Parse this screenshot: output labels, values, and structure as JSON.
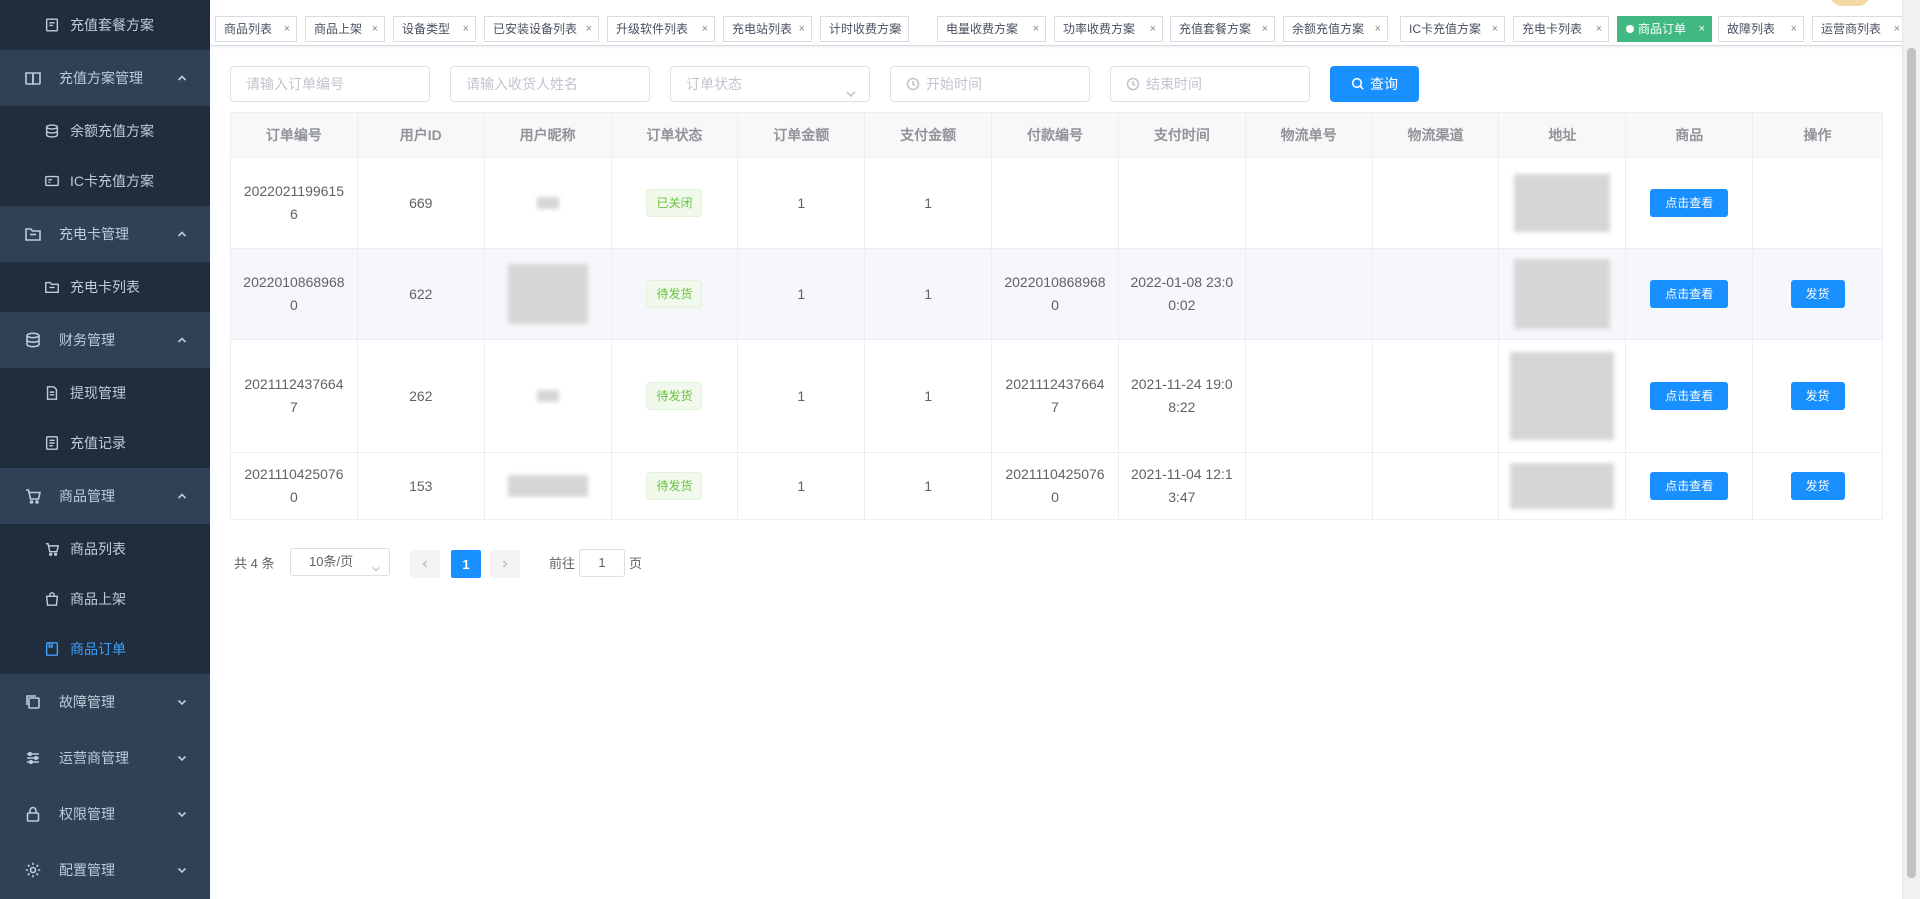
{
  "sidebar": {
    "items": [
      {
        "label": "充值套餐方案",
        "icon": "package-icon",
        "type": "sub"
      },
      {
        "label": "充值方案管理",
        "icon": "book-icon",
        "type": "group"
      },
      {
        "label": "余额充值方案",
        "icon": "database-icon",
        "type": "sub"
      },
      {
        "label": "IC卡充值方案",
        "icon": "card-icon",
        "type": "sub"
      },
      {
        "label": "充电卡管理",
        "icon": "folder-icon",
        "type": "group"
      },
      {
        "label": "充电卡列表",
        "icon": "folder-icon",
        "type": "sub"
      },
      {
        "label": "财务管理",
        "icon": "database-icon",
        "type": "group"
      },
      {
        "label": "提现管理",
        "icon": "document-icon",
        "type": "sub"
      },
      {
        "label": "充值记录",
        "icon": "list-icon",
        "type": "sub"
      },
      {
        "label": "商品管理",
        "icon": "cart-icon",
        "type": "group"
      },
      {
        "label": "商品列表",
        "icon": "cart-icon",
        "type": "sub"
      },
      {
        "label": "商品上架",
        "icon": "bag-icon",
        "type": "sub"
      },
      {
        "label": "商品订单",
        "icon": "order-icon",
        "type": "sub",
        "active": true
      },
      {
        "label": "故障管理",
        "icon": "copy-icon",
        "type": "group"
      },
      {
        "label": "运营商管理",
        "icon": "sliders-icon",
        "type": "group"
      },
      {
        "label": "权限管理",
        "icon": "lock-icon",
        "type": "group"
      },
      {
        "label": "配置管理",
        "icon": "gear-icon",
        "type": "group"
      }
    ]
  },
  "tags": [
    {
      "label": "商品列表"
    },
    {
      "label": "商品上架"
    },
    {
      "label": "设备类型"
    },
    {
      "label": "已安装设备列表"
    },
    {
      "label": "升级软件列表"
    },
    {
      "label": "充电站列表"
    },
    {
      "label": "计时收费方案"
    },
    {
      "label": "电量收费方案"
    },
    {
      "label": "功率收费方案"
    },
    {
      "label": "充值套餐方案"
    },
    {
      "label": "余额充值方案"
    },
    {
      "label": "IC卡充值方案"
    },
    {
      "label": "充电卡列表"
    },
    {
      "label": "商品订单",
      "active": true
    },
    {
      "label": "故障列表"
    },
    {
      "label": "运营商列表"
    }
  ],
  "filters": {
    "order_no_placeholder": "请输入订单编号",
    "receiver_placeholder": "请输入收货人姓名",
    "status_placeholder": "订单状态",
    "start_placeholder": "开始时间",
    "end_placeholder": "结束时间",
    "query_label": "查询"
  },
  "table": {
    "columns": [
      "订单编号",
      "用户ID",
      "用户昵称",
      "订单状态",
      "订单金额",
      "支付金额",
      "付款编号",
      "支付时间",
      "物流单号",
      "物流渠道",
      "地址",
      "商品",
      "操作"
    ],
    "rows": [
      {
        "order_no": "20220211996156",
        "user_id": "669",
        "status": "已关闭",
        "status_type": "closed",
        "amount": "1",
        "paid": "1",
        "pay_no": "",
        "pay_time": "",
        "logistics_no": "",
        "channel": "",
        "view": "点击查看",
        "action": ""
      },
      {
        "order_no": "20220108689680",
        "user_id": "622",
        "status": "待发货",
        "status_type": "pending",
        "amount": "1",
        "paid": "1",
        "pay_no": "20220108689680",
        "pay_time": "2022-01-08 23:00:02",
        "logistics_no": "",
        "channel": "",
        "view": "点击查看",
        "action": "发货"
      },
      {
        "order_no": "20211124376647",
        "user_id": "262",
        "status": "待发货",
        "status_type": "pending",
        "amount": "1",
        "paid": "1",
        "pay_no": "20211124376647",
        "pay_time": "2021-11-24 19:08:22",
        "logistics_no": "",
        "channel": "",
        "view": "点击查看",
        "action": "发货"
      },
      {
        "order_no": "20211104250760",
        "user_id": "153",
        "status": "待发货",
        "status_type": "pending",
        "amount": "1",
        "paid": "1",
        "pay_no": "20211104250760",
        "pay_time": "2021-11-04 12:13:47",
        "logistics_no": "",
        "channel": "",
        "view": "点击查看",
        "action": "发货"
      }
    ]
  },
  "pagination": {
    "total": "共 4 条",
    "page_size": "10条/页",
    "current": "1",
    "goto_prefix": "前往",
    "goto_value": "1",
    "goto_suffix": "页"
  },
  "colors": {
    "sidebar_bg": "#304156",
    "submenu_bg": "#1f2d3d",
    "accent": "#1890ff",
    "active_tag": "#42b983",
    "status_green": "#67c23a"
  }
}
